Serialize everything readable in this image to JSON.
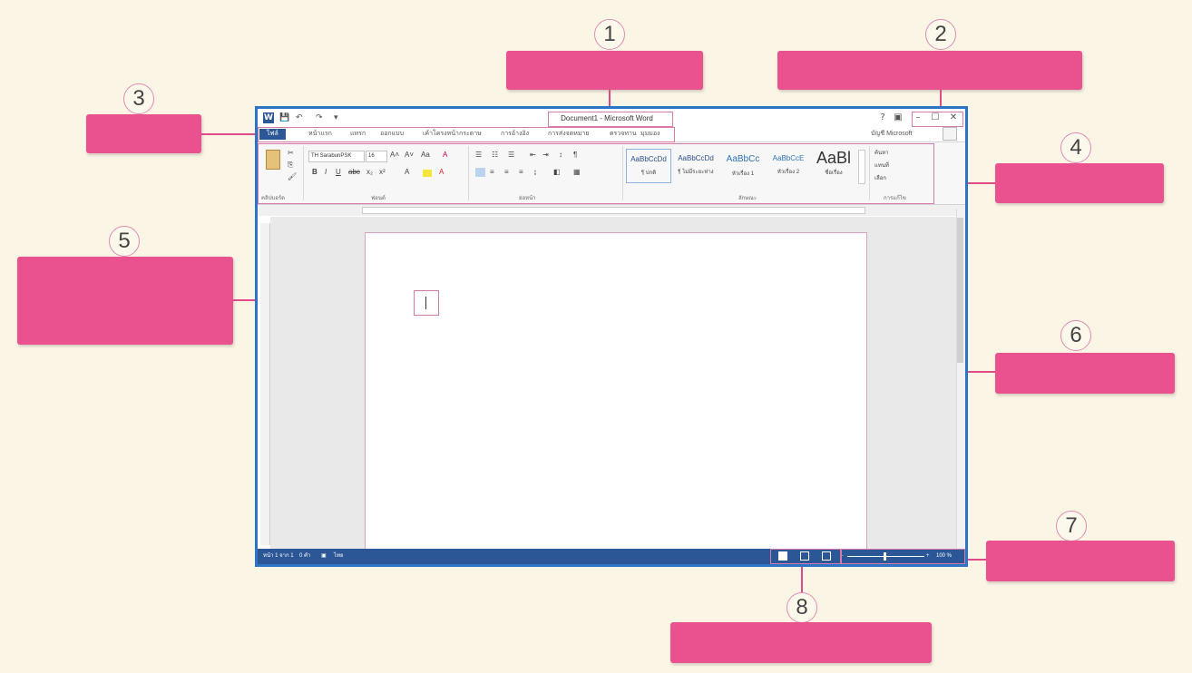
{
  "colors": {
    "background": "#fbf5e6",
    "callout_pink": "#e9518f",
    "window_border": "#2b74c7",
    "status_bar": "#2b5797"
  },
  "callout_numbers": [
    "1",
    "2",
    "3",
    "4",
    "5",
    "6",
    "7",
    "8"
  ],
  "word": {
    "title": "Document1 - Microsoft Word",
    "window_controls": [
      "?",
      "▣",
      "–",
      "☐",
      "✕"
    ],
    "quick_access": [
      "W",
      "💾",
      "↶",
      "↷",
      "▾"
    ],
    "tabs": [
      "ไฟล์",
      "หน้าแรก",
      "แทรก",
      "ออกแบบ",
      "เค้าโครงหน้ากระดาษ",
      "การอ้างอิง",
      "การส่งจดหมาย",
      "ตรวจทาน",
      "มุมมอง"
    ],
    "account": "บัญชี Microsoft",
    "ribbon": {
      "font_name": "TH SarabunPSK",
      "font_size": "16",
      "group_labels": [
        "คลิปบอร์ด",
        "ฟอนต์",
        "ย่อหน้า",
        "ลักษณะ",
        "การแก้ไข"
      ],
      "styles": [
        {
          "sample": "AaBbCcDd",
          "name": "¶ ปกติ"
        },
        {
          "sample": "AaBbCcDd",
          "name": "¶ ไม่มีระยะห่าง"
        },
        {
          "sample": "AaBbCc",
          "name": "หัวเรื่อง 1"
        },
        {
          "sample": "AaBbCcE",
          "name": "หัวเรื่อง 2"
        },
        {
          "sample": "AaBl",
          "name": "ชื่อเรื่อง"
        }
      ],
      "editing": [
        "ค้นหา",
        "แทนที่",
        "เลือก"
      ]
    },
    "status": {
      "page": "หน้า 1 จาก 1",
      "words": "0 คำ",
      "language": "ไทย",
      "zoom": "100 %"
    }
  }
}
